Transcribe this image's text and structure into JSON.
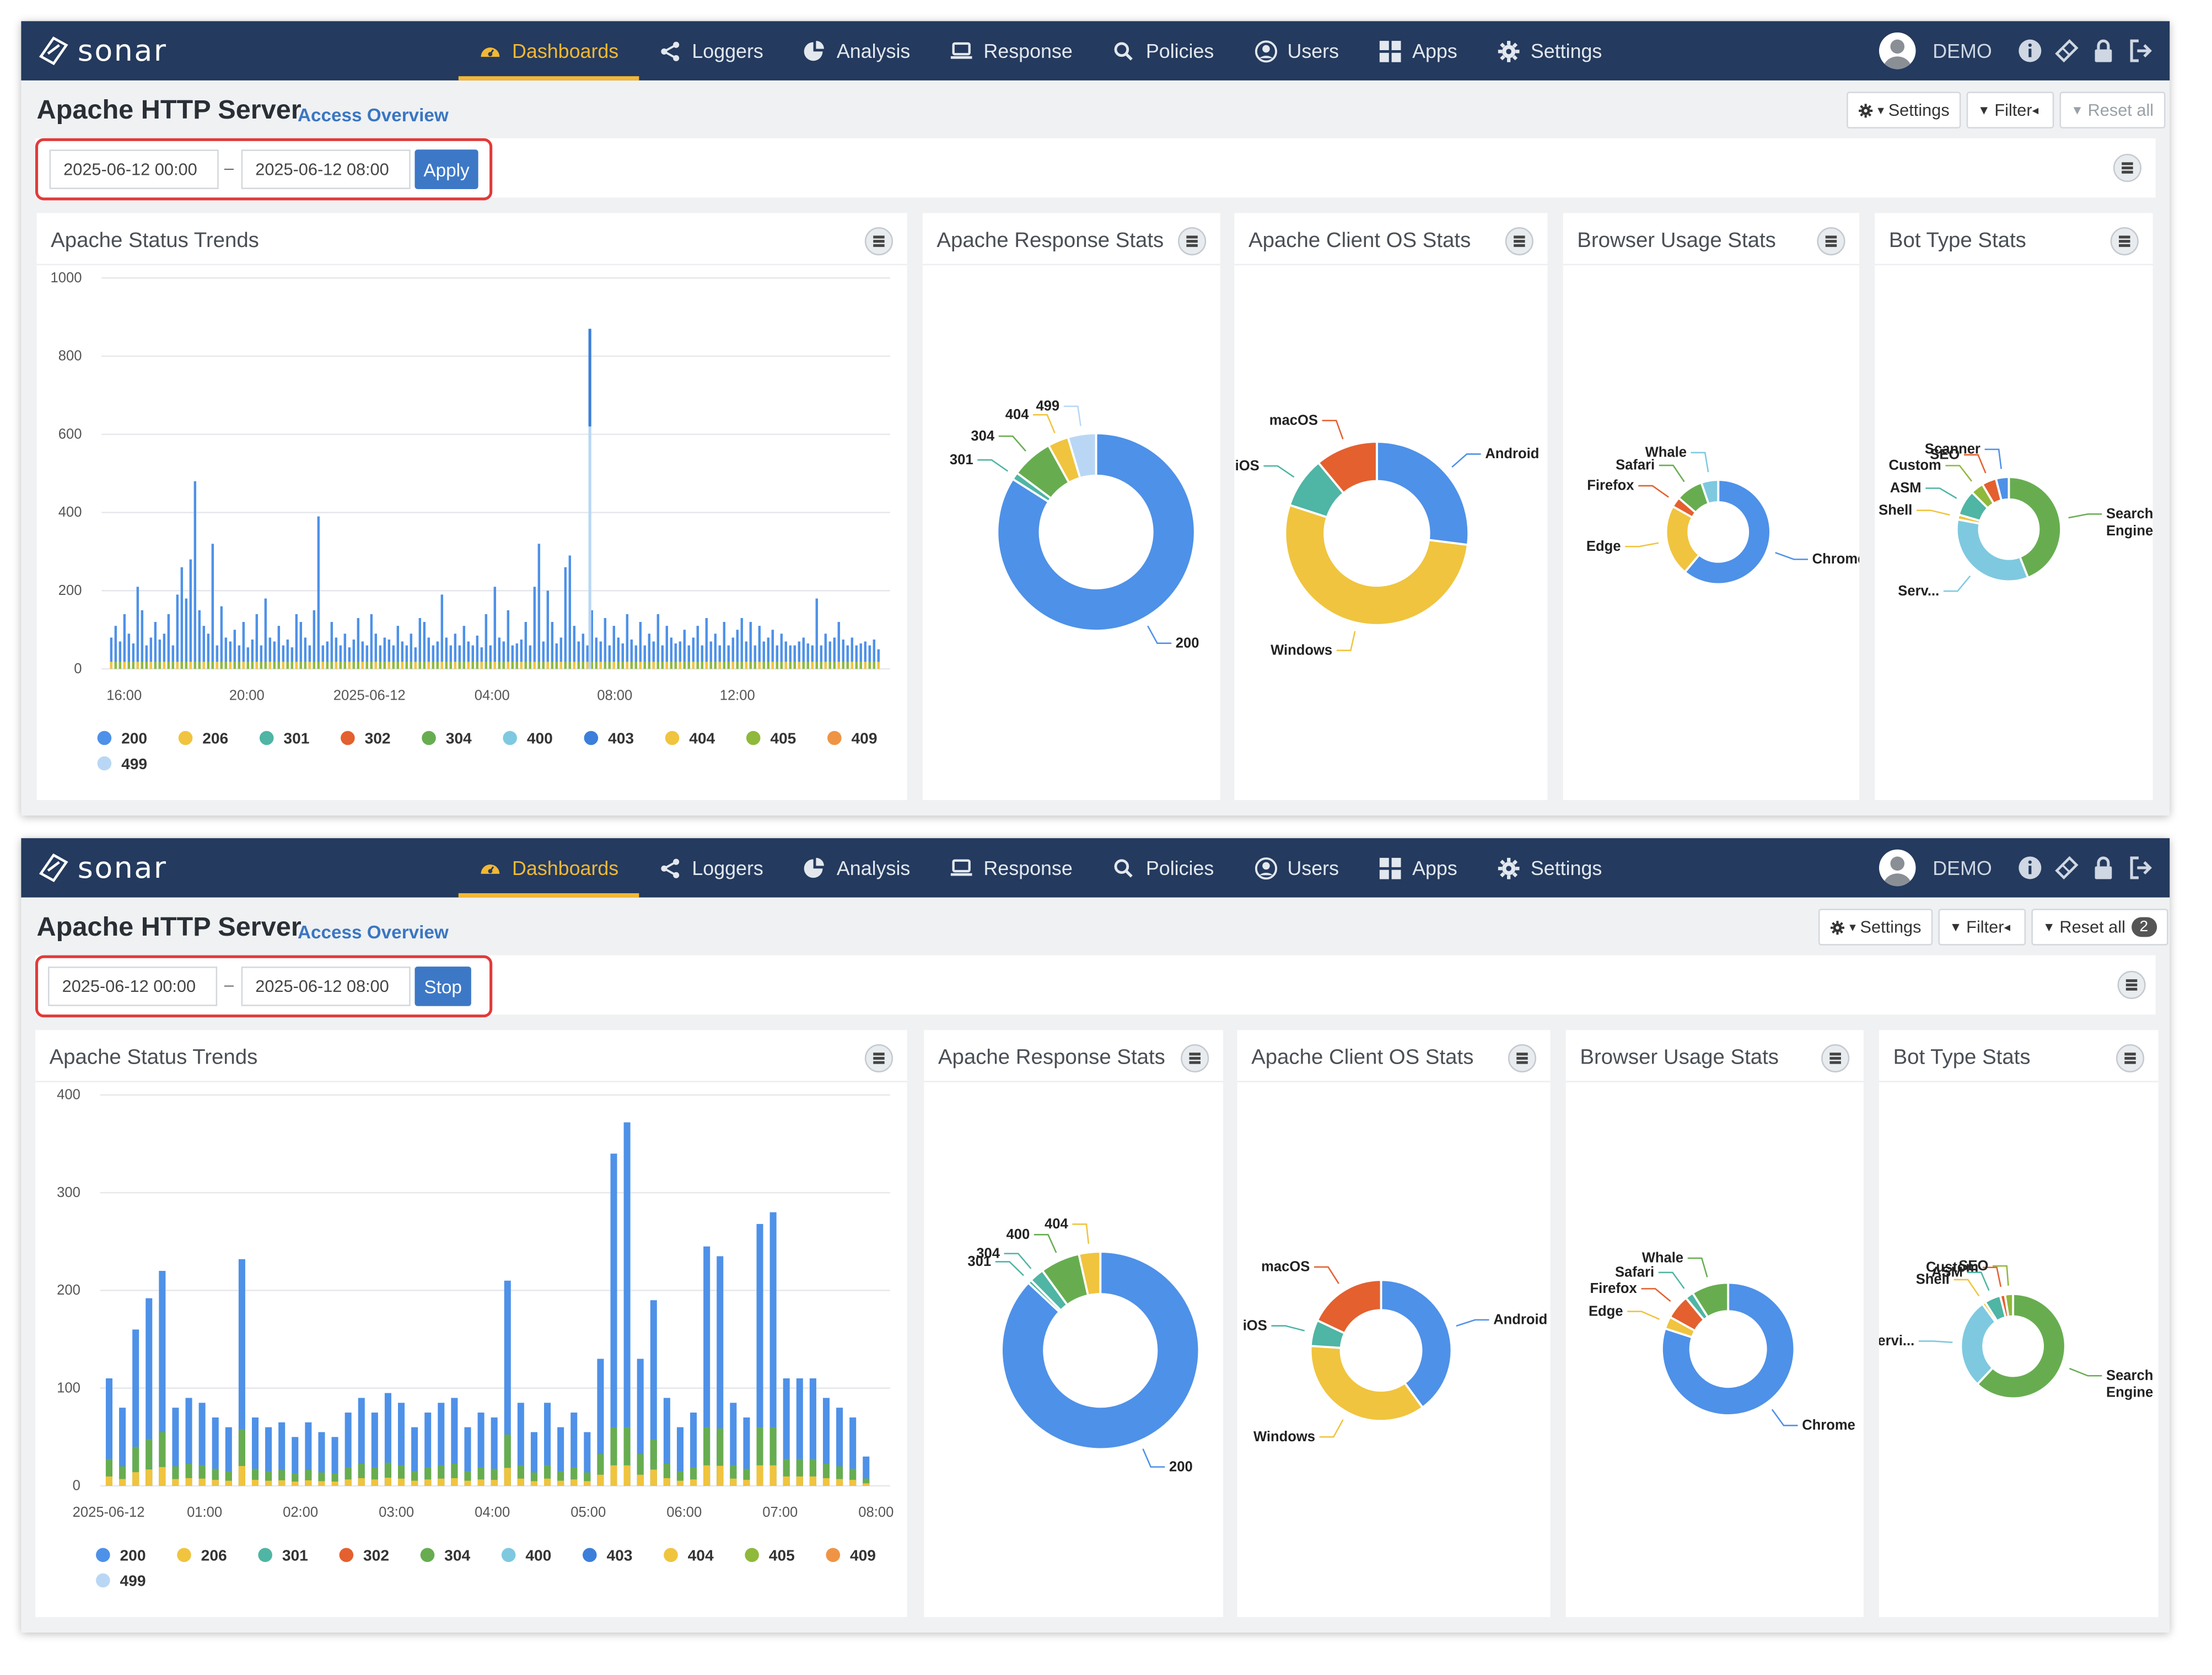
{
  "nav": {
    "brand": "sonar",
    "items": [
      {
        "label": "Dashboards",
        "icon": "dashboard-icon",
        "active": true
      },
      {
        "label": "Loggers",
        "icon": "share-icon"
      },
      {
        "label": "Analysis",
        "icon": "pie-chart-icon"
      },
      {
        "label": "Response",
        "icon": "laptop-icon"
      },
      {
        "label": "Policies",
        "icon": "search-icon"
      },
      {
        "label": "Users",
        "icon": "user-circle-icon"
      },
      {
        "label": "Apps",
        "icon": "grid-icon"
      },
      {
        "label": "Settings",
        "icon": "gear-icon"
      }
    ],
    "user": "DEMO",
    "right_icons": [
      "info-icon",
      "ticket-icon",
      "lock-icon",
      "logout-icon"
    ],
    "accent": "#f2b835",
    "bg": "#243a5e"
  },
  "views": [
    {
      "title": "Apache HTTP Server",
      "subtitle": "Access Overview",
      "toolbar": {
        "settings": "Settings",
        "filter": "Filter",
        "reset": "Reset all",
        "reset_count": "",
        "reset_disabled": true
      },
      "date_from": "2025-06-12 00:00",
      "date_sep": "–",
      "date_to": "2025-06-12 08:00",
      "date_button": "Apply",
      "card_titles": [
        "Apache Status Trends",
        "Apache Response Stats",
        "Apache Client OS Stats",
        "Browser Usage Stats",
        "Bot Type Stats"
      ]
    },
    {
      "title": "Apache HTTP Server",
      "subtitle": "Access Overview",
      "toolbar": {
        "settings": "Settings",
        "filter": "Filter",
        "reset": "Reset all",
        "reset_count": "2",
        "reset_disabled": false
      },
      "date_from": "2025-06-12 00:00",
      "date_sep": "–",
      "date_to": "2025-06-12 08:00",
      "date_button": "Stop",
      "card_titles": [
        "Apache Status Trends",
        "Apache Response Stats",
        "Apache Client OS Stats",
        "Browser Usage Stats",
        "Bot Type Stats"
      ]
    }
  ],
  "chart_data": [
    {
      "view": 1,
      "type": "bar",
      "title": "Apache Status Trends",
      "stacked": true,
      "y_ticks": [
        0,
        200,
        400,
        600,
        800,
        1000
      ],
      "ylim": [
        0,
        1000
      ],
      "x_ticks": [
        "16:00",
        "20:00",
        "2025-06-12",
        "04:00",
        "08:00",
        "12:00"
      ],
      "x_range_hours": [
        -9.2,
        15.2
      ],
      "series": [
        {
          "name": "200",
          "color": "#4e91e8",
          "values": [
            80,
            110,
            70,
            140,
            90,
            65,
            210,
            150,
            60,
            80,
            120,
            75,
            90,
            140,
            60,
            190,
            260,
            180,
            280,
            480,
            150,
            110,
            90,
            320,
            60,
            160,
            80,
            70,
            100,
            60,
            120,
            55,
            75,
            140,
            60,
            180,
            80,
            70,
            110,
            60,
            75,
            55,
            140,
            120,
            80,
            60,
            150,
            390,
            60,
            70,
            120,
            80,
            60,
            90,
            55,
            75,
            130,
            70,
            60,
            140,
            90,
            60,
            80,
            75,
            60,
            110,
            70,
            60,
            90,
            55,
            130,
            120,
            80,
            60,
            70,
            190,
            80,
            60,
            90,
            60,
            110,
            70,
            60,
            85,
            55,
            140,
            60,
            210,
            80,
            70,
            150,
            60,
            65,
            75,
            120,
            60,
            210,
            320,
            70,
            200,
            120,
            65,
            80,
            260,
            290,
            110,
            70,
            90,
            60,
            150,
            80,
            70,
            130,
            60,
            110,
            80,
            65,
            140,
            75,
            60,
            120,
            60,
            90,
            70,
            140,
            60,
            110,
            80,
            65,
            70,
            100,
            60,
            80,
            110,
            60,
            130,
            70,
            90,
            60,
            120,
            60,
            80,
            100,
            130,
            70,
            120,
            60,
            110,
            70,
            80,
            100,
            60,
            90,
            70,
            60,
            60,
            70,
            80,
            65,
            60,
            180,
            60,
            90,
            70,
            80,
            120,
            75,
            60,
            80,
            60,
            65,
            70,
            60,
            75,
            50
          ]
        },
        {
          "name": "206",
          "color": "#f0c43e",
          "values": [
            6
          ]
        },
        {
          "name": "301",
          "color": "#4fb5a4",
          "values": [
            3
          ]
        },
        {
          "name": "302",
          "color": "#e4602f",
          "values": [
            1
          ]
        },
        {
          "name": "304",
          "color": "#67ad50",
          "values": [
            5
          ]
        },
        {
          "name": "400",
          "color": "#7ec9e0",
          "values": [
            1
          ]
        },
        {
          "name": "403",
          "color": "#3b7fdb",
          "values": [
            1
          ]
        },
        {
          "name": "404",
          "color": "#f0c43e",
          "values": [
            4
          ]
        },
        {
          "name": "405",
          "color": "#8fb93a",
          "values": [
            2
          ]
        },
        {
          "name": "409",
          "color": "#ef9445",
          "values": [
            1
          ]
        },
        {
          "name": "499",
          "color": "#b9d7f5",
          "values": [
            1
          ]
        }
      ],
      "spike": {
        "x_hour": 10.0,
        "value": 870,
        "light_value": 620
      }
    },
    {
      "view": 1,
      "type": "pie",
      "donut": true,
      "title": "Apache Response Stats",
      "slices": [
        {
          "label": "200",
          "value": 84,
          "color": "#4e91e8"
        },
        {
          "label": "301",
          "value": 1.2,
          "color": "#4fb5a4"
        },
        {
          "label": "304",
          "value": 6.8,
          "color": "#67ad50"
        },
        {
          "label": "404",
          "value": 3.4,
          "color": "#f0c43e"
        },
        {
          "label": "499",
          "value": 4.6,
          "color": "#b9d7f5"
        }
      ]
    },
    {
      "view": 1,
      "type": "pie",
      "donut": true,
      "title": "Apache Client OS Stats",
      "slices": [
        {
          "label": "Android",
          "value": 27,
          "color": "#4e91e8"
        },
        {
          "label": "Windows",
          "value": 53,
          "color": "#f0c43e"
        },
        {
          "label": "iOS",
          "value": 9,
          "color": "#4fb5a4"
        },
        {
          "label": "macOS",
          "value": 11,
          "color": "#e4602f"
        }
      ]
    },
    {
      "view": 1,
      "type": "pie",
      "donut": true,
      "title": "Browser Usage Stats",
      "slices": [
        {
          "label": "Chrome",
          "value": 58,
          "color": "#4e91e8"
        },
        {
          "label": "Edge",
          "value": 21,
          "color": "#f0c43e"
        },
        {
          "label": "Firefox",
          "value": 3,
          "color": "#e4602f"
        },
        {
          "label": "Safari",
          "value": 8,
          "color": "#67ad50"
        },
        {
          "label": "Whale",
          "value": 5,
          "color": "#7ec9e0"
        }
      ]
    },
    {
      "view": 1,
      "type": "pie",
      "donut": true,
      "title": "Bot Type Stats",
      "slices": [
        {
          "label": "Search Engine",
          "value": 44,
          "color": "#67ad50"
        },
        {
          "label": "Serv...",
          "value": 34,
          "color": "#7ec9e0"
        },
        {
          "label": "Shell",
          "value": 1.5,
          "color": "#f0c43e"
        },
        {
          "label": "ASM",
          "value": 8,
          "color": "#4fb5a4"
        },
        {
          "label": "Custom",
          "value": 4,
          "color": "#8fb93a"
        },
        {
          "label": "SEO",
          "value": 4.5,
          "color": "#e4602f"
        },
        {
          "label": "Scanner",
          "value": 4,
          "color": "#4e91e8"
        }
      ]
    },
    {
      "view": 2,
      "type": "bar",
      "title": "Apache Status Trends",
      "stacked": true,
      "y_ticks": [
        0,
        100,
        200,
        300,
        400
      ],
      "ylim": [
        0,
        400
      ],
      "x_ticks": [
        "2025-06-12",
        "01:00",
        "02:00",
        "03:00",
        "04:00",
        "05:00",
        "06:00",
        "07:00",
        "08:00"
      ],
      "x_range_hours": [
        0,
        8
      ],
      "bar_values_total": [
        110,
        80,
        160,
        192,
        220,
        80,
        90,
        85,
        70,
        60,
        232,
        70,
        60,
        65,
        50,
        65,
        55,
        50,
        75,
        90,
        75,
        95,
        85,
        60,
        75,
        85,
        90,
        60,
        75,
        70,
        210,
        85,
        55,
        85,
        60,
        75,
        55,
        130,
        340,
        372,
        130,
        190,
        90,
        60,
        75,
        245,
        235,
        85,
        70,
        268,
        280,
        110,
        110,
        110,
        90,
        80,
        70,
        30
      ],
      "stack_colors": [
        "#4e91e8",
        "#67ad50",
        "#8fb93a",
        "#f0c43e",
        "#4fb5a4"
      ]
    },
    {
      "view": 2,
      "type": "pie",
      "donut": true,
      "title": "Apache Response Stats",
      "slices": [
        {
          "label": "200",
          "value": 87,
          "color": "#4e91e8"
        },
        {
          "label": "301",
          "value": 0.6,
          "color": "#4fb5a4"
        },
        {
          "label": "304",
          "value": 2.4,
          "color": "#4fb5a4"
        },
        {
          "label": "400",
          "value": 6.5,
          "color": "#67ad50"
        },
        {
          "label": "404",
          "value": 3.5,
          "color": "#f0c43e"
        }
      ]
    },
    {
      "view": 2,
      "type": "pie",
      "donut": true,
      "title": "Apache Client OS Stats",
      "slices": [
        {
          "label": "Android",
          "value": 40,
          "color": "#4e91e8"
        },
        {
          "label": "Windows",
          "value": 36,
          "color": "#f0c43e"
        },
        {
          "label": "iOS",
          "value": 6,
          "color": "#4fb5a4"
        },
        {
          "label": "macOS",
          "value": 18,
          "color": "#e4602f"
        }
      ]
    },
    {
      "view": 2,
      "type": "pie",
      "donut": true,
      "title": "Browser Usage Stats",
      "slices": [
        {
          "label": "Chrome",
          "value": 80,
          "color": "#4e91e8"
        },
        {
          "label": "Edge",
          "value": 3,
          "color": "#f0c43e"
        },
        {
          "label": "Firefox",
          "value": 6,
          "color": "#e4602f"
        },
        {
          "label": "Safari",
          "value": 2,
          "color": "#4fb5a4"
        },
        {
          "label": "Whale",
          "value": 9,
          "color": "#67ad50"
        }
      ]
    },
    {
      "view": 2,
      "type": "pie",
      "donut": true,
      "title": "Bot Type Stats",
      "slices": [
        {
          "label": "Search Engine",
          "value": 62,
          "color": "#67ad50"
        },
        {
          "label": "Servi...",
          "value": 28,
          "color": "#7ec9e0"
        },
        {
          "label": "Shell",
          "value": 1,
          "color": "#f0c43e"
        },
        {
          "label": "ASM",
          "value": 5,
          "color": "#4fb5a4"
        },
        {
          "label": "Custom",
          "value": 1.5,
          "color": "#e4602f"
        },
        {
          "label": "SEO",
          "value": 2.5,
          "color": "#8fb93a"
        }
      ]
    }
  ],
  "legend": [
    {
      "label": "200",
      "color": "#4e91e8"
    },
    {
      "label": "206",
      "color": "#f0c43e"
    },
    {
      "label": "301",
      "color": "#4fb5a4"
    },
    {
      "label": "302",
      "color": "#e4602f"
    },
    {
      "label": "304",
      "color": "#67ad50"
    },
    {
      "label": "400",
      "color": "#7ec9e0"
    },
    {
      "label": "403",
      "color": "#3b7fdb"
    },
    {
      "label": "404",
      "color": "#f0c43e"
    },
    {
      "label": "405",
      "color": "#8fb93a"
    },
    {
      "label": "409",
      "color": "#ef9445"
    },
    {
      "label": "499",
      "color": "#b9d7f5"
    }
  ]
}
